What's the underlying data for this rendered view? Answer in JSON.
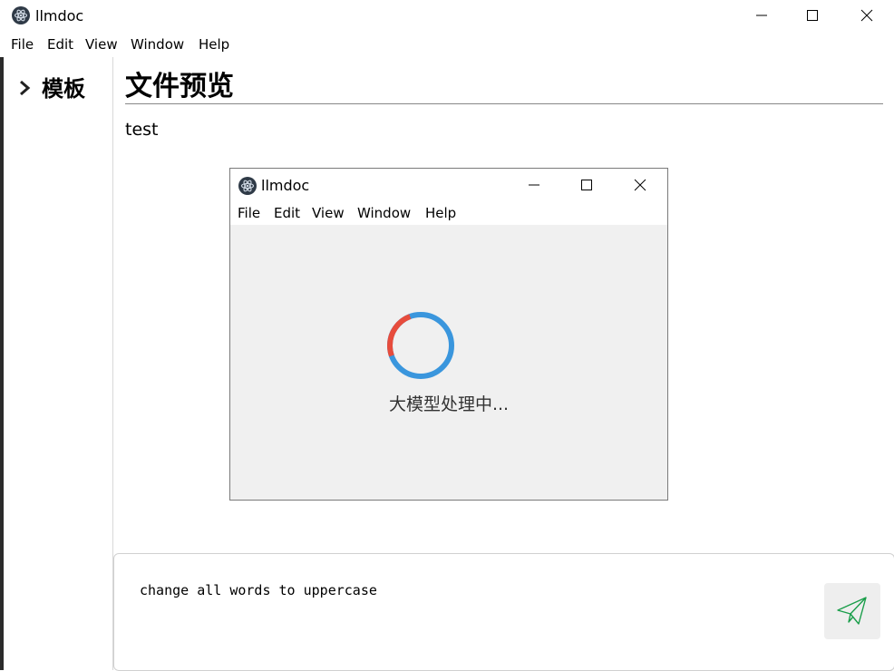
{
  "window": {
    "title": "llmdoc",
    "menu": [
      "File",
      "Edit",
      "View",
      "Window",
      "Help"
    ]
  },
  "sidebar": {
    "items": [
      {
        "label": "模板",
        "icon": "chevron-right-icon"
      }
    ]
  },
  "main": {
    "title": "文件预览",
    "doc_text": "test"
  },
  "preview_window": {
    "title": "llmdoc",
    "menu": [
      "File",
      "Edit",
      "View",
      "Window",
      "Help"
    ],
    "loading_text": "大模型处理中...",
    "spinner_colors": {
      "primary": "#3a96dd",
      "accent": "#e74c3c"
    }
  },
  "chat": {
    "input_value": "change all words to uppercase",
    "send_icon": "paper-plane-icon",
    "send_color": "#1a9e4a"
  },
  "colors": {
    "app_icon_bg": "#2f3a47"
  }
}
